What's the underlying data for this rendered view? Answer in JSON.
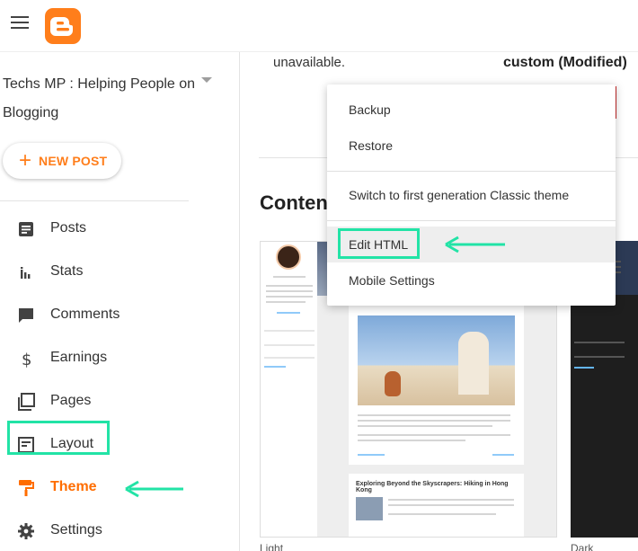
{
  "app": {
    "logo_icon": "blogger-logo-icon",
    "menu_icon": "hamburger-menu-icon",
    "accent_color": "#ff7e1b",
    "highlight_color": "#22e3a6"
  },
  "sidebar": {
    "blog_title": "Techs MP : Helping People on Blogging",
    "new_post_label": "NEW POST",
    "items": [
      {
        "label": "Posts",
        "icon": "posts-icon"
      },
      {
        "label": "Stats",
        "icon": "stats-icon"
      },
      {
        "label": "Comments",
        "icon": "comments-icon"
      },
      {
        "label": "Earnings",
        "icon": "dollar-icon"
      },
      {
        "label": "Pages",
        "icon": "pages-icon"
      },
      {
        "label": "Layout",
        "icon": "layout-icon"
      },
      {
        "label": "Theme",
        "icon": "theme-roller-icon",
        "active": true
      },
      {
        "label": "Settings",
        "icon": "gear-icon"
      }
    ]
  },
  "main": {
    "status_text": "unavailable.",
    "theme_status": "custom (Modified)",
    "section_heading": "Conten",
    "preview_light_caption": "Light",
    "preview_dark_caption": "Dark",
    "preview_post_title": "Exploring Beyond the Skyscrapers: Hiking in Hong Kong"
  },
  "dropdown": {
    "items": [
      {
        "label": "Backup"
      },
      {
        "label": "Restore"
      },
      {
        "label": "Switch to first generation Classic theme"
      },
      {
        "label": "Edit HTML",
        "highlighted": true
      },
      {
        "label": "Mobile Settings"
      }
    ]
  }
}
